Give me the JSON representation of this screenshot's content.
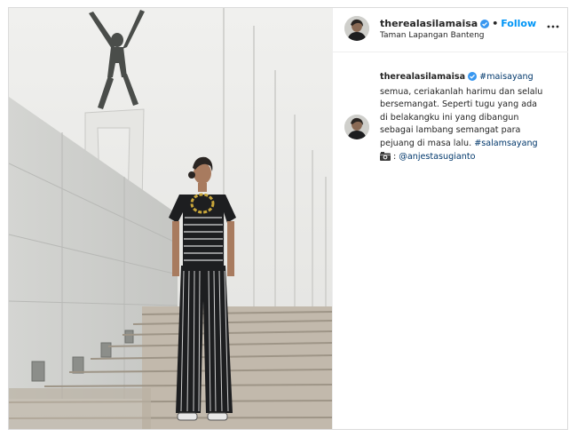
{
  "post": {
    "username": "therealasilamaisa",
    "follow_label": "Follow",
    "separator": "•",
    "location": "Taman Lapangan Banteng"
  },
  "caption": {
    "username": "therealasilamaisa",
    "hashtag1": "#maisayang",
    "line1": "semua, ceriakanlah harimu dan selalu",
    "line2": "bersemangat. Seperti tugu yang ada",
    "line3": "di belakangku ini yang dibangun",
    "line4": "sebagai lambang semangat para",
    "line5": "pejuang di masa lalu.",
    "hashtag2": "#salamsayang",
    "credit_prefix": ":",
    "credit_mention": "@anjestasugianto"
  },
  "colors": {
    "link": "#00376b",
    "follow": "#0095f6",
    "verified": "#3897f0"
  },
  "icons": [
    "verified-badge-icon",
    "more-options-icon",
    "camera-icon"
  ]
}
